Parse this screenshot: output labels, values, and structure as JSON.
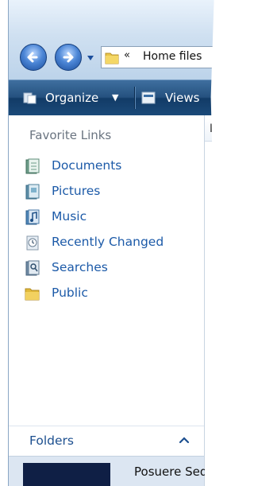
{
  "address_bar": {
    "breadcrumb_chevron": "«",
    "path_text": "Home files"
  },
  "toolbar": {
    "organize_label": "Organize",
    "organize_arrow": "▼",
    "views_label": "Views"
  },
  "nav_pane": {
    "favorites_heading": "Favorite Links",
    "favorites": [
      {
        "label": "Documents",
        "icon": "documents-icon"
      },
      {
        "label": "Pictures",
        "icon": "pictures-icon"
      },
      {
        "label": "Music",
        "icon": "music-icon"
      },
      {
        "label": "Recently Changed",
        "icon": "recently-changed-icon"
      },
      {
        "label": "Searches",
        "icon": "searches-icon"
      },
      {
        "label": "Public",
        "icon": "public-folder-icon"
      }
    ],
    "folders_label": "Folders"
  },
  "file_list": {
    "column_header_partial": "N",
    "bottom_item_text": "Posuere Sed"
  },
  "colors": {
    "toolbar_dark": "#1b4a79",
    "link_blue": "#1c5aa8",
    "heading_gray": "#6a7480"
  }
}
